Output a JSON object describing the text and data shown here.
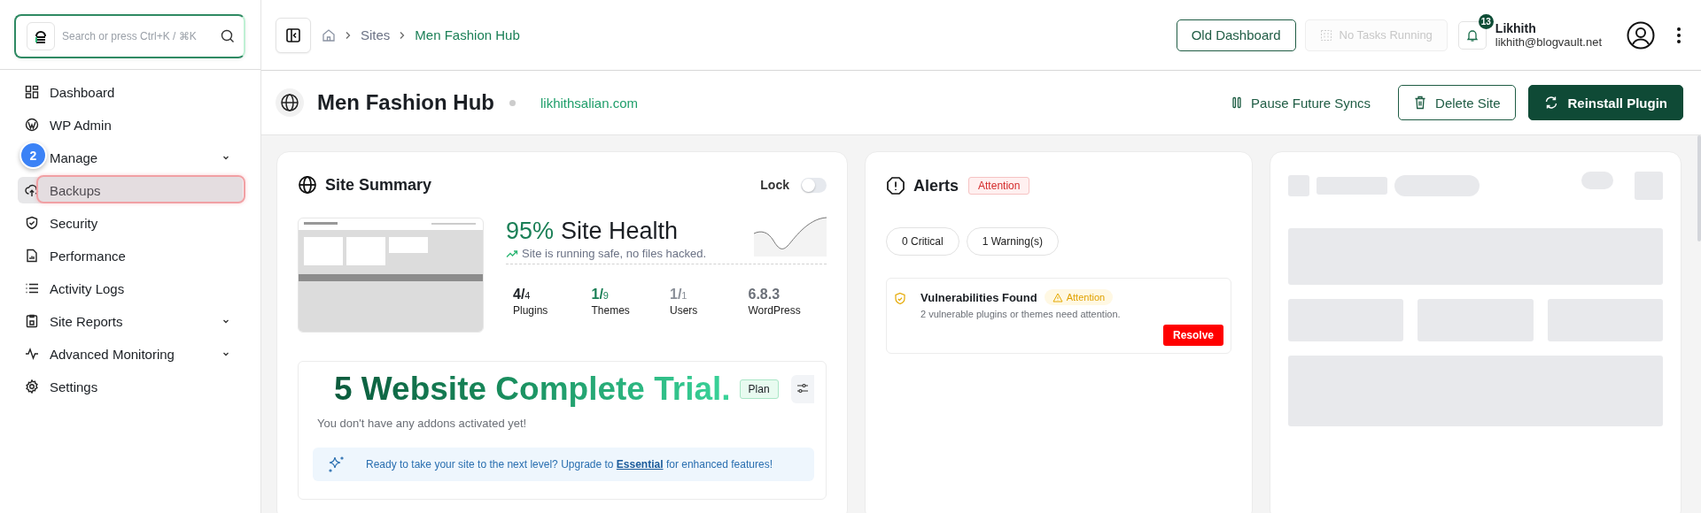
{
  "sidebar": {
    "search": {
      "placeholder": "Search or press Ctrl+K / ⌘K"
    },
    "items": [
      {
        "label": "Dashboard",
        "kind": "link",
        "selected": false
      },
      {
        "label": "WP Admin",
        "kind": "link",
        "selected": false
      },
      {
        "label": "Manage",
        "kind": "group",
        "selected": false
      },
      {
        "label": "Backups",
        "kind": "link",
        "selected": true
      },
      {
        "label": "Security",
        "kind": "link",
        "selected": false
      },
      {
        "label": "Performance",
        "kind": "link",
        "selected": false
      },
      {
        "label": "Activity Logs",
        "kind": "link",
        "selected": false
      },
      {
        "label": "Site Reports",
        "kind": "group",
        "selected": false
      },
      {
        "label": "Advanced Monitoring",
        "kind": "group",
        "selected": false
      },
      {
        "label": "Settings",
        "kind": "link",
        "selected": false
      }
    ],
    "tour_step": "2"
  },
  "topbar": {
    "breadcrumb": [
      "Sites",
      "Men Fashion Hub"
    ],
    "buttons": [
      {
        "label": "Old Dashboard",
        "disabled": false
      },
      {
        "label": "No Tasks Running",
        "disabled": true
      }
    ],
    "notifications": "13",
    "user": {
      "name": "Likhith",
      "email": "likhith@blogvault.net"
    }
  },
  "site": {
    "title": "Men Fashion Hub",
    "domain": "likhithsalian.com",
    "actions": [
      {
        "label": "Pause Future Syncs",
        "kind": "link"
      },
      {
        "label": "Delete Site",
        "kind": "outline"
      },
      {
        "label": "Reinstall Plugin",
        "kind": "primary"
      }
    ]
  },
  "summary": {
    "title": "Site Summary",
    "lock": {
      "label": "Lock",
      "on": false
    },
    "health": {
      "percent": "95%",
      "label": "Site Health",
      "status": "Site is running safe, no files hacked."
    },
    "stats": [
      {
        "count": "4/",
        "total": "4",
        "label": "Plugins",
        "color": "#1f2328"
      },
      {
        "count": "1/",
        "total": "9",
        "label": "Themes",
        "color": "#1a7f56"
      },
      {
        "count": "1/",
        "total": "1",
        "label": "Users",
        "color": "#8a8f98"
      },
      {
        "count": "6.8.3",
        "label": "WordPress",
        "color": "#6b7079"
      }
    ],
    "trial": {
      "heading": "5 Website Complete Trial.",
      "tag": "Plan",
      "note": "You don't have any addons activated yet!",
      "upgrade": {
        "before": "Ready to take your site to the next level? Upgrade to",
        "link": "Essential",
        "after": "for enhanced features!"
      }
    }
  },
  "alerts": {
    "title": "Alerts",
    "badge": "Attention",
    "pills": [
      "0 Critical",
      "1 Warning(s)"
    ],
    "items": [
      {
        "title": "Vulnerabilities Found",
        "badge": "Attention",
        "description": "2 vulnerable plugins or themes need attention.",
        "action": "Resolve"
      }
    ]
  }
}
